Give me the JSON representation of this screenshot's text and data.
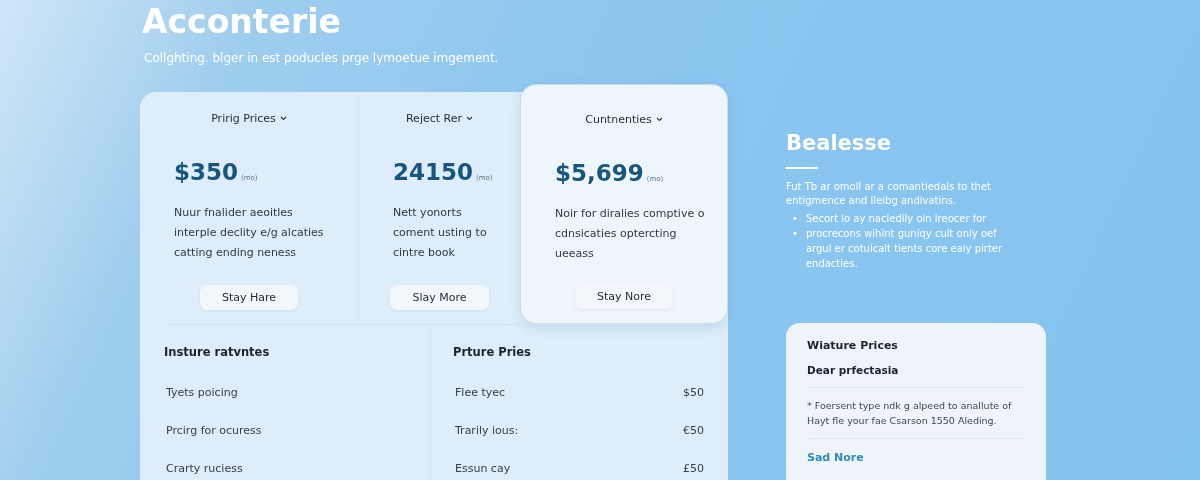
{
  "hero": {
    "title": "Acconterie",
    "subtitle": "Collghting. blger in est poducles prge lymoetue imgement."
  },
  "plans": [
    {
      "name": "Pririg Prices",
      "price": "$350",
      "suffix": "(mo)",
      "description": "Nuur fnalider aeoitles interple declity e/g alcaties catting ending neness",
      "button": "Stay Hare",
      "selected": false
    },
    {
      "name": "Reject Rer",
      "price": "24150",
      "suffix": "(mo)",
      "description": "Nett yonorts coment usting to cintre book",
      "button": "Slay More",
      "selected": false
    },
    {
      "name": "Cuntnenties",
      "price": "$5,699",
      "suffix": "(mo)",
      "description": "Noir for diralies comptive o cdnsicaties optercting ueeass",
      "button": "Stay Nore",
      "selected": true
    }
  ],
  "features": {
    "heading": "Insture ratvntes",
    "rows": [
      "Tyets poicing",
      "Prcirg for ocuress",
      "Crarty ruciess"
    ]
  },
  "prices": {
    "heading": "Prture Pries",
    "rows": [
      {
        "label": "Flee tyec",
        "value": "$50"
      },
      {
        "label": "Trarily ious:",
        "value": "€50"
      },
      {
        "label": "Essun cay",
        "value": "£50"
      }
    ]
  },
  "aside": {
    "title": "Bealesse",
    "paragraph": "Fut Tb ar omoll ar a comantiedals to thet entigmence and lleibg andivatins.",
    "marker": "•",
    "bullets": [
      "Secort lo ay nacledily oin lreocer for",
      "procrecons wihint guniqy cult only oef argul er cotuicalt tients core eaiy pirter endacties."
    ]
  },
  "card": {
    "title": "Wiature Prices",
    "subtitle": "Dear prfectasia",
    "note": "* Foersent type ndk g alpeed to anallute of Hayt fle your fae Csarson 1550 Aleding.",
    "link": "Sad Nore"
  }
}
